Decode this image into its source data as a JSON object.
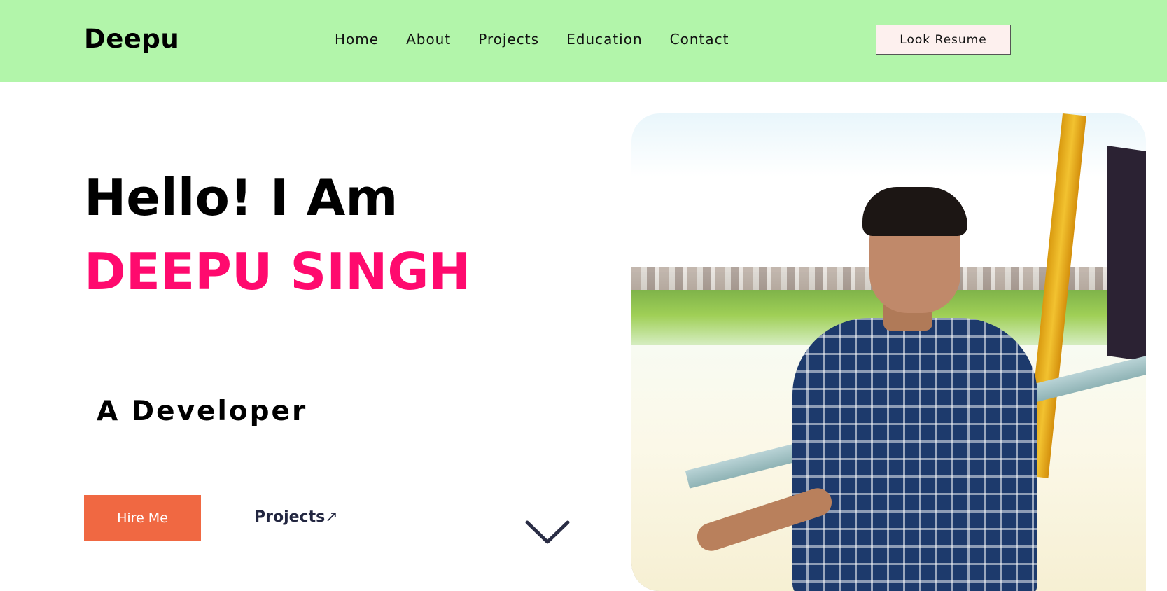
{
  "header": {
    "logo": "Deepu",
    "nav": [
      {
        "label": "Home"
      },
      {
        "label": "About"
      },
      {
        "label": "Projects"
      },
      {
        "label": "Education"
      },
      {
        "label": "Contact"
      }
    ],
    "resume_button": "Look Resume",
    "background_color": "#b2f5aa"
  },
  "hero": {
    "greeting": "Hello! I Am",
    "name": "DEEPU SINGH",
    "role": "A Developer",
    "hire_button": "Hire Me",
    "projects_link": "Projects",
    "projects_link_icon": "↗",
    "name_color": "#ff0a6e",
    "hire_button_color": "#f06842"
  },
  "icons": {
    "scroll_down": "chevron-down-icon",
    "projects_arrow": "arrow-up-right-icon"
  }
}
